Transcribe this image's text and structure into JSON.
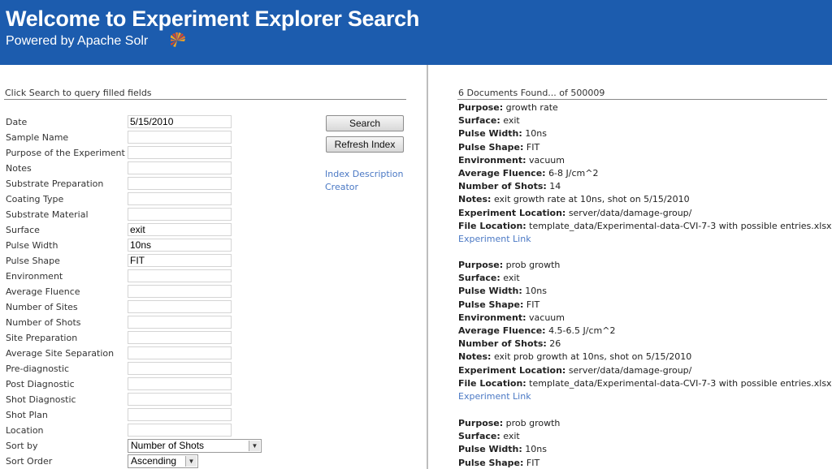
{
  "header": {
    "title": "Welcome to Experiment Explorer Search",
    "subtitle": "Powered by Apache Solr"
  },
  "search_form": {
    "hint": "Click Search to query filled fields",
    "fields": [
      {
        "label": "Date",
        "value": "5/15/2010"
      },
      {
        "label": "Sample Name",
        "value": ""
      },
      {
        "label": "Purpose of the Experiment",
        "value": ""
      },
      {
        "label": "Notes",
        "value": ""
      },
      {
        "label": "Substrate Preparation",
        "value": ""
      },
      {
        "label": "Coating Type",
        "value": ""
      },
      {
        "label": "Substrate Material",
        "value": ""
      },
      {
        "label": "Surface",
        "value": "exit"
      },
      {
        "label": "Pulse Width",
        "value": "10ns"
      },
      {
        "label": "Pulse Shape",
        "value": "FIT"
      },
      {
        "label": "Environment",
        "value": ""
      },
      {
        "label": "Average Fluence",
        "value": ""
      },
      {
        "label": "Number of Sites",
        "value": ""
      },
      {
        "label": "Number of Shots",
        "value": ""
      },
      {
        "label": "Site Preparation",
        "value": ""
      },
      {
        "label": "Average Site Separation",
        "value": ""
      },
      {
        "label": "Pre-diagnostic",
        "value": ""
      },
      {
        "label": "Post Diagnostic",
        "value": ""
      },
      {
        "label": "Shot Diagnostic",
        "value": ""
      },
      {
        "label": "Shot Plan",
        "value": ""
      },
      {
        "label": "Location",
        "value": ""
      }
    ],
    "sort_by": {
      "label": "Sort by",
      "value": "Number of Shots"
    },
    "sort_order": {
      "label": "Sort Order",
      "value": "Ascending"
    },
    "search_button": "Search",
    "refresh_button": "Refresh Index",
    "links": [
      "Index Description",
      "Creator"
    ]
  },
  "results": {
    "summary": "6 Documents Found... of 500009",
    "link_label": "Experiment Link",
    "documents": [
      {
        "fields": [
          {
            "key": "Purpose:",
            "value": "growth rate"
          },
          {
            "key": "Surface:",
            "value": "exit"
          },
          {
            "key": "Pulse Width:",
            "value": "10ns"
          },
          {
            "key": "Pulse Shape:",
            "value": "FIT"
          },
          {
            "key": "Environment:",
            "value": "vacuum"
          },
          {
            "key": "Average Fluence:",
            "value": "6-8 J/cm^2"
          },
          {
            "key": "Number of Shots:",
            "value": "14"
          },
          {
            "key": "Notes:",
            "value": "exit growth rate at 10ns, shot on 5/15/2010"
          },
          {
            "key": "Experiment Location:",
            "value": "server/data/damage-group/"
          },
          {
            "key": "File Location:",
            "value": "template_data/Experimental-data-CVI-7-3 with possible entries.xlsx"
          }
        ]
      },
      {
        "fields": [
          {
            "key": "Purpose:",
            "value": "prob growth"
          },
          {
            "key": "Surface:",
            "value": "exit"
          },
          {
            "key": "Pulse Width:",
            "value": "10ns"
          },
          {
            "key": "Pulse Shape:",
            "value": "FIT"
          },
          {
            "key": "Environment:",
            "value": "vacuum"
          },
          {
            "key": "Average Fluence:",
            "value": "4.5-6.5 J/cm^2"
          },
          {
            "key": "Number of Shots:",
            "value": "26"
          },
          {
            "key": "Notes:",
            "value": "exit prob growth at 10ns, shot on 5/15/2010"
          },
          {
            "key": "Experiment Location:",
            "value": "server/data/damage-group/"
          },
          {
            "key": "File Location:",
            "value": "template_data/Experimental-data-CVI-7-3 with possible entries.xlsx"
          }
        ]
      },
      {
        "fields": [
          {
            "key": "Purpose:",
            "value": "prob growth"
          },
          {
            "key": "Surface:",
            "value": "exit"
          },
          {
            "key": "Pulse Width:",
            "value": "10ns"
          },
          {
            "key": "Pulse Shape:",
            "value": "FIT"
          }
        ]
      }
    ]
  },
  "colors": {
    "header_bg": "#1c5cae",
    "link": "#4a78c4"
  }
}
